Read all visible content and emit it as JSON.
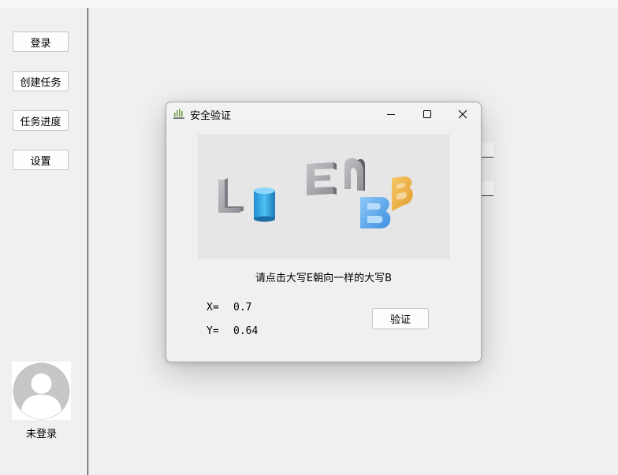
{
  "sidebar": {
    "buttons": [
      {
        "label": "登录"
      },
      {
        "label": "创建任务"
      },
      {
        "label": "任务进度"
      },
      {
        "label": "设置"
      }
    ],
    "user_status": "未登录"
  },
  "dialog": {
    "title": "安全验证",
    "icon": "app-logo-icon",
    "captcha": {
      "letters": [
        "L",
        "E",
        "n",
        "B",
        "B"
      ],
      "shapes": [
        "cylinder"
      ]
    },
    "prompt": "请点击大写E朝向一样的大写B",
    "x_label": "X=",
    "x_value": "0.7",
    "y_label": "Y=",
    "y_value": "0.64",
    "verify_label": "验证"
  },
  "colors": {
    "accent_blue": "#5aa6ee",
    "accent_orange": "#f0b548",
    "cylinder_blue": "#39a8e2"
  }
}
